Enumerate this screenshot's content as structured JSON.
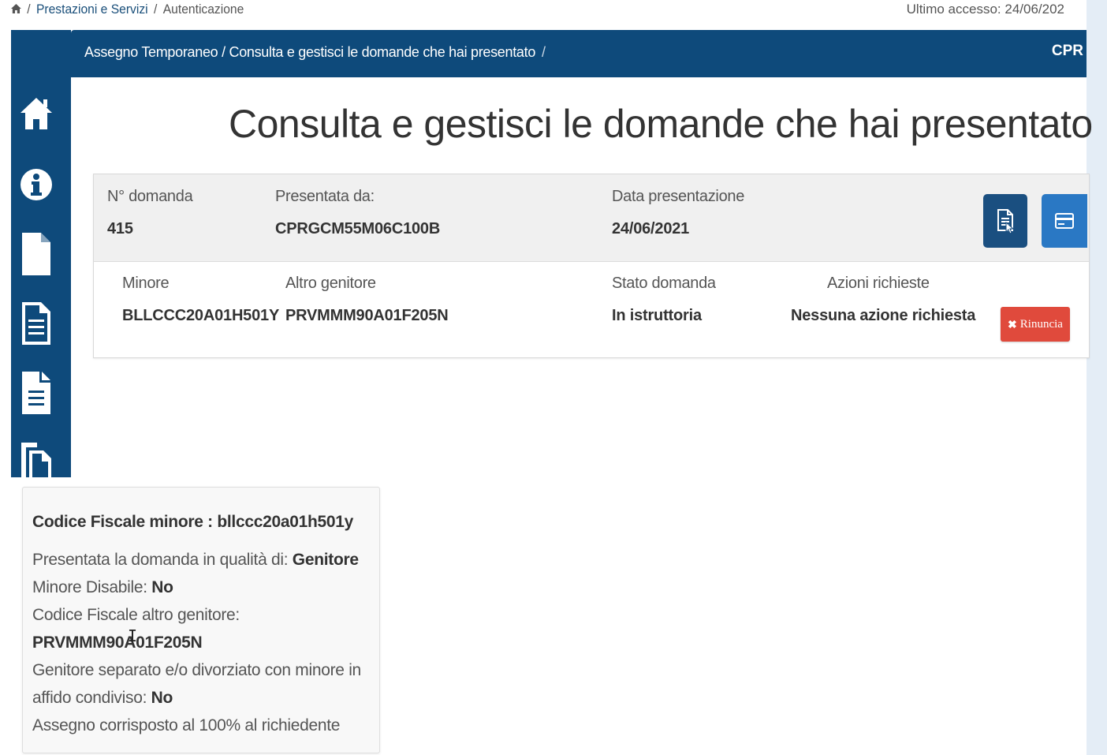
{
  "breadcrumb": {
    "home_icon": "home-icon",
    "items": [
      "Prestazioni e Servizi",
      "Autenticazione"
    ]
  },
  "last_access": "Ultimo accesso: 24/06/202",
  "header": {
    "breadcrumb": "Assegno Temporaneo / Consulta e gestisci le domande che hai presentato",
    "separator": "/",
    "user": "CPR"
  },
  "sidebar": {
    "icons": [
      "home-icon",
      "info-icon",
      "file-icon",
      "file-text-icon",
      "file-lines-icon",
      "files-icon"
    ]
  },
  "page_title": "Consulta e gestisci le domande che hai presentato",
  "application": {
    "labels": {
      "number": "N° domanda",
      "submitted_by": "Presentata da:",
      "date": "Data presentazione",
      "minor": "Minore",
      "other_parent": "Altro genitore",
      "status": "Stato domanda",
      "actions": "Azioni richieste"
    },
    "number": "415",
    "submitted_by": "CPRGCM55M06C100B",
    "date": "24/06/2021",
    "minor": "BLLCCC20A01H501Y",
    "other_parent": "PRVMMM90A01F205N",
    "status": "In istruttoria",
    "actions": "Nessuna azione richiesta",
    "buttons": {
      "detail_icon": "document-icon",
      "payment_icon": "credit-card-icon",
      "rinuncia_label": "Rinuncia"
    }
  },
  "popover": {
    "title": "Codice Fiscale minore : bllccc20a01h501y",
    "role_label": "Presentata la domanda in qualità di: ",
    "role_value": "Genitore",
    "disabled_label": "Minore Disabile: ",
    "disabled_value": "No",
    "other_parent_label": "Codice Fiscale altro genitore:",
    "other_parent_value": "PRVMMM90A01F205N",
    "separated_label_1": "Genitore separato e/o divorziato con minore in",
    "separated_label_2": "affido condiviso: ",
    "separated_value": "No",
    "payment_note": "Assegno corrisposto al 100% al richiedente"
  }
}
